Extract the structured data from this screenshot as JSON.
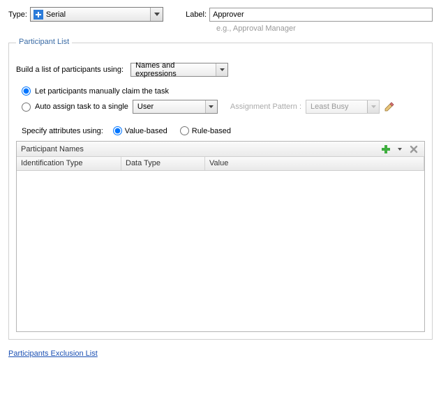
{
  "top": {
    "type_label": "Type:",
    "type_value": "Serial",
    "label_label": "Label:",
    "label_value": "Approver",
    "hint": "e.g., Approval Manager"
  },
  "fieldset": {
    "legend": "Participant List",
    "build_label": "Build a list of participants using:",
    "build_value": "Names and expressions",
    "opt_claim": "Let participants manually claim the task",
    "opt_auto": "Auto assign task to a single",
    "auto_value": "User",
    "pattern_label": "Assignment Pattern :",
    "pattern_value": "Least Busy",
    "spec_label": "Specify attributes using:",
    "spec_value": "Value-based",
    "spec_rule": "Rule-based"
  },
  "table": {
    "title": "Participant Names",
    "col1": "Identification Type",
    "col2": "Data Type",
    "col3": "Value"
  },
  "footer": {
    "link": "Participants Exclusion List"
  }
}
